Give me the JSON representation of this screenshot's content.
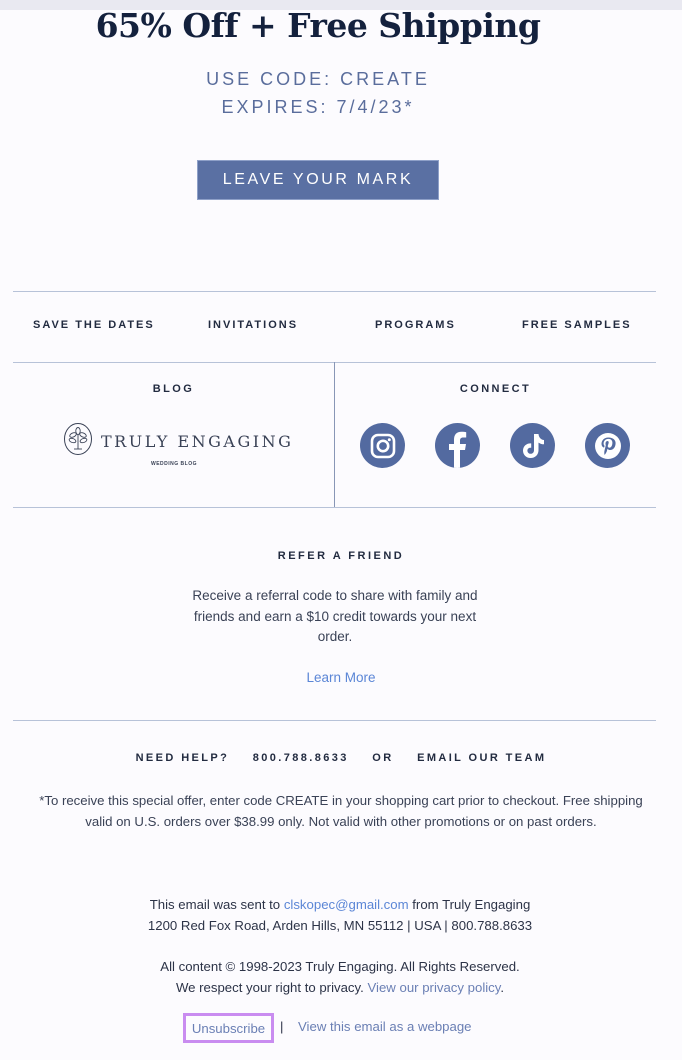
{
  "hero": {
    "title": "65% Off + Free Shipping",
    "code_line": "USE CODE: CREATE",
    "expires_line": "EXPIRES: 7/4/23*",
    "cta_label": "LEAVE YOUR MARK"
  },
  "nav": {
    "items": [
      {
        "label": "SAVE THE DATES"
      },
      {
        "label": "INVITATIONS"
      },
      {
        "label": "PROGRAMS"
      },
      {
        "label": "FREE SAMPLES"
      }
    ]
  },
  "blog": {
    "heading": "BLOG",
    "logo_text": "TRULY ENGAGING",
    "logo_subtitle": "WEDDING BLOG"
  },
  "connect": {
    "heading": "CONNECT",
    "icons": [
      {
        "name": "instagram-icon"
      },
      {
        "name": "facebook-icon"
      },
      {
        "name": "tiktok-icon"
      },
      {
        "name": "pinterest-icon"
      }
    ],
    "icon_color": "#536aa0"
  },
  "refer": {
    "heading": "REFER A FRIEND",
    "body": "Receive a referral code to share with family and friends and earn a $10 credit towards your next order.",
    "link_label": "Learn More"
  },
  "help": {
    "need_help": "NEED HELP?",
    "phone": "800.788.8633",
    "or": "OR",
    "email_team": "EMAIL OUR TEAM"
  },
  "disclaimer": "*To receive this special offer, enter code CREATE in your shopping cart prior to checkout. Free shipping valid on U.S. orders over $38.99 only. Not valid with other promotions or on past orders.",
  "footer": {
    "sent_prefix": "This email was sent to ",
    "email": "clskopec@gmail.com",
    "sent_suffix": " from Truly Engaging",
    "address": "1200 Red Fox Road, Arden Hills, MN 55112 | USA | 800.788.8633",
    "copyright": "All content © 1998-2023 Truly Engaging. All Rights Reserved.",
    "privacy_prefix": "We respect your right to privacy. ",
    "privacy_link": "View our privacy policy",
    "privacy_suffix": ".",
    "unsubscribe": "Unsubscribe",
    "separator": "|",
    "webpage_link": "View this email as a webpage"
  },
  "colors": {
    "accent": "#5a70a3",
    "link": "#5b86d6",
    "highlight_box": "#c98cf0"
  }
}
